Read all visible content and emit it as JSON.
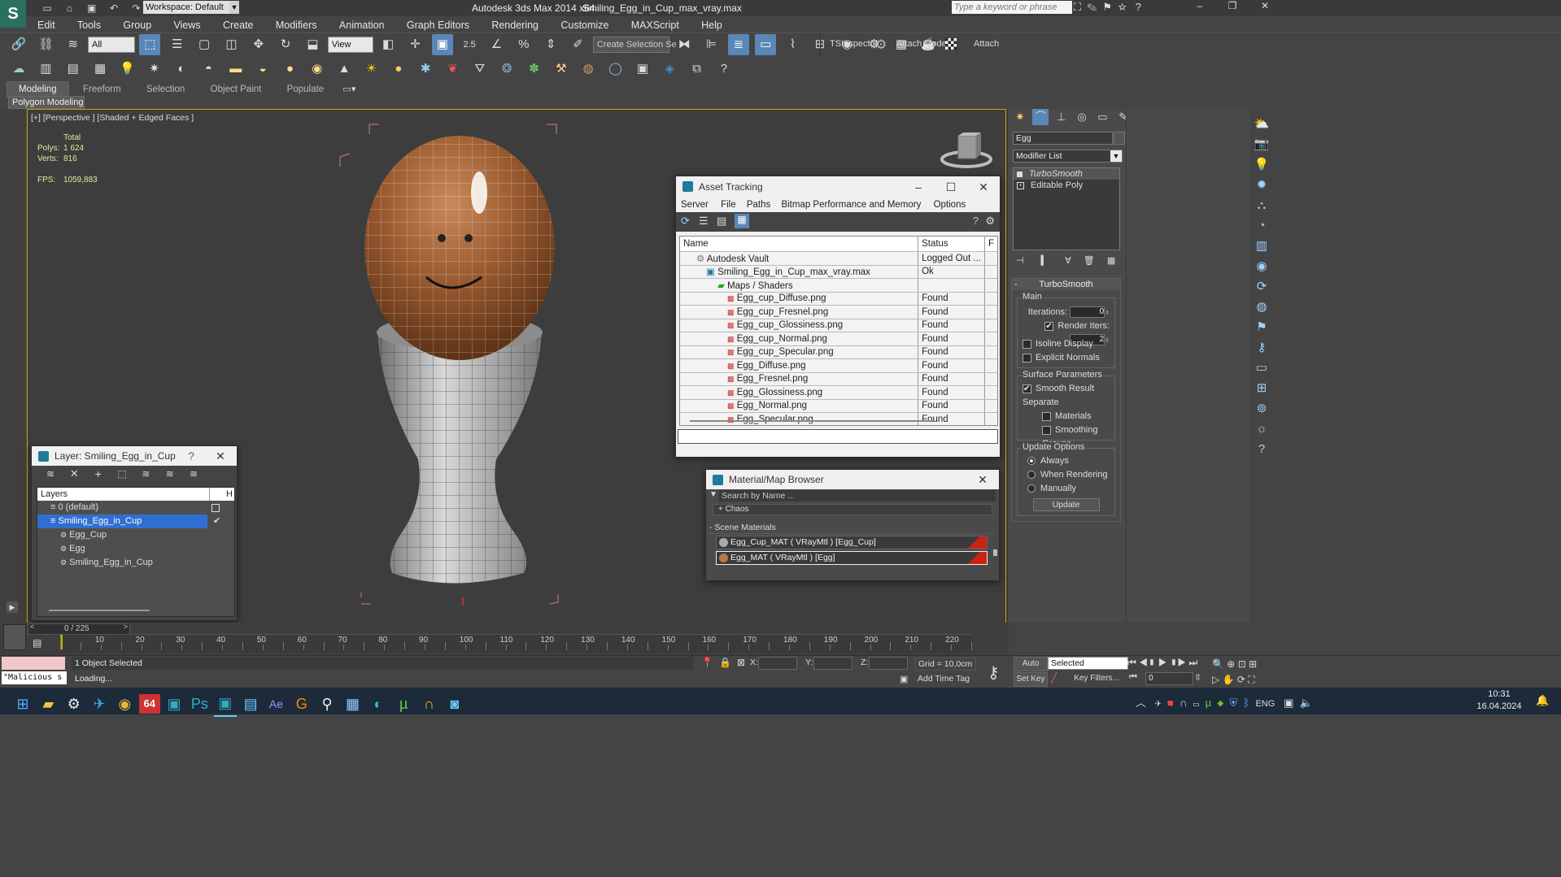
{
  "app": {
    "title": "Autodesk 3ds Max  2014 x64",
    "file_name": "Smiling_Egg_in_Cup_max_vray.max",
    "workspace": "Workspace: Default",
    "search_placeholder": "Type a keyword or phrase"
  },
  "menu": [
    "Edit",
    "Tools",
    "Group",
    "Views",
    "Create",
    "Modifiers",
    "Animation",
    "Graph Editors",
    "Rendering",
    "Customize",
    "MAXScript",
    "Help"
  ],
  "toolbar": {
    "selection_filter": "All",
    "ref_coord": "View",
    "named_selection": "Create Selection Se",
    "snap_label": "2.5",
    "tsinspector": "TSInspector",
    "attach_mode": "Attach Mode",
    "attach": "Attach"
  },
  "ribbon": {
    "tabs": [
      "Modeling",
      "Freeform",
      "Selection",
      "Object Paint",
      "Populate"
    ],
    "panel_label": "Polygon Modeling"
  },
  "viewport": {
    "label": "[+] [Perspective ] [Shaded + Edged Faces ]",
    "stats_header": "Total",
    "polys_label": "Polys:",
    "polys_value": "1 624",
    "verts_label": "Verts:",
    "verts_value": "816",
    "fps_label": "FPS:",
    "fps_value": "1059,883"
  },
  "asset_tracking": {
    "title": "Asset Tracking",
    "menu": [
      "Server",
      "File",
      "Paths",
      "Bitmap Performance and Memory",
      "Options"
    ],
    "columns": [
      "Name",
      "Status",
      "F"
    ],
    "rows": [
      {
        "name": "Autodesk Vault",
        "status": "Logged Out ..."
      },
      {
        "name": "Smiling_Egg_in_Cup_max_vray.max",
        "status": "Ok"
      },
      {
        "name": "Maps / Shaders",
        "status": ""
      },
      {
        "name": "Egg_cup_Diffuse.png",
        "status": "Found"
      },
      {
        "name": "Egg_cup_Fresnel.png",
        "status": "Found"
      },
      {
        "name": "Egg_cup_Glossiness.png",
        "status": "Found"
      },
      {
        "name": "Egg_cup_Normal.png",
        "status": "Found"
      },
      {
        "name": "Egg_cup_Specular.png",
        "status": "Found"
      },
      {
        "name": "Egg_Diffuse.png",
        "status": "Found"
      },
      {
        "name": "Egg_Fresnel.png",
        "status": "Found"
      },
      {
        "name": "Egg_Glossiness.png",
        "status": "Found"
      },
      {
        "name": "Egg_Normal.png",
        "status": "Found"
      },
      {
        "name": "Egg_Specular.png",
        "status": "Found"
      }
    ]
  },
  "material_browser": {
    "title": "Material/Map Browser",
    "search_placeholder": "Search by Name ...",
    "chaos_label": "+ Chaos",
    "scene_materials_label": "- Scene Materials",
    "items": [
      "Egg_Cup_MAT  ( VRayMtl )  [Egg_Cup]",
      "Egg_MAT  ( VRayMtl )  [Egg]"
    ]
  },
  "layer_panel": {
    "title": "Layer: Smiling_Egg_in_Cup",
    "help": "?",
    "column": "Layers",
    "hidden_col": "H",
    "items": [
      "0 (default)",
      "Smiling_Egg_in_Cup",
      "Egg_Cup",
      "Egg",
      "Smiling_Egg_in_Cup"
    ]
  },
  "command_panel": {
    "object_name": "Egg",
    "modifier_list": "Modifier List",
    "stack": [
      "TurboSmooth",
      "Editable Poly"
    ],
    "rollout_title": "TurboSmooth",
    "main_label": "Main",
    "iterations_label": "Iterations:",
    "iterations_value": "0",
    "render_iters_label": "Render Iters:",
    "render_iters_value": "2",
    "isoline_display": "Isoline Display",
    "explicit_normals": "Explicit Normals",
    "surface_params": "Surface Parameters",
    "smooth_result": "Smooth Result",
    "separate": "Separate",
    "materials": "Materials",
    "smoothing_groups": "Smoothing Groups",
    "update_options": "Update Options",
    "always": "Always",
    "when_rendering": "When Rendering",
    "manually": "Manually",
    "update_button": "Update"
  },
  "timeline": {
    "frame_counter": "0 / 225",
    "ticks": [
      "10",
      "20",
      "30",
      "40",
      "50",
      "60",
      "70",
      "80",
      "90",
      "100",
      "110",
      "120",
      "130",
      "140",
      "150",
      "160",
      "170",
      "180",
      "190",
      "200",
      "210",
      "220"
    ]
  },
  "status": {
    "maxscript": "\"Malicious s",
    "selected": "1 Object Selected",
    "loading": "Loading...",
    "x_label": "X:",
    "y_label": "Y:",
    "z_label": "Z:",
    "grid": "Grid = 10,0cm",
    "add_time_tag": "Add Time Tag",
    "auto_key": "Auto Key",
    "set_key": "Set Key",
    "key_mode": "Selected",
    "key_filters": "Key Filters...",
    "frame_value": "0"
  },
  "taskbar": {
    "lang": "ENG",
    "time": "10:31",
    "date": "16.04.2024",
    "badge": "64"
  }
}
